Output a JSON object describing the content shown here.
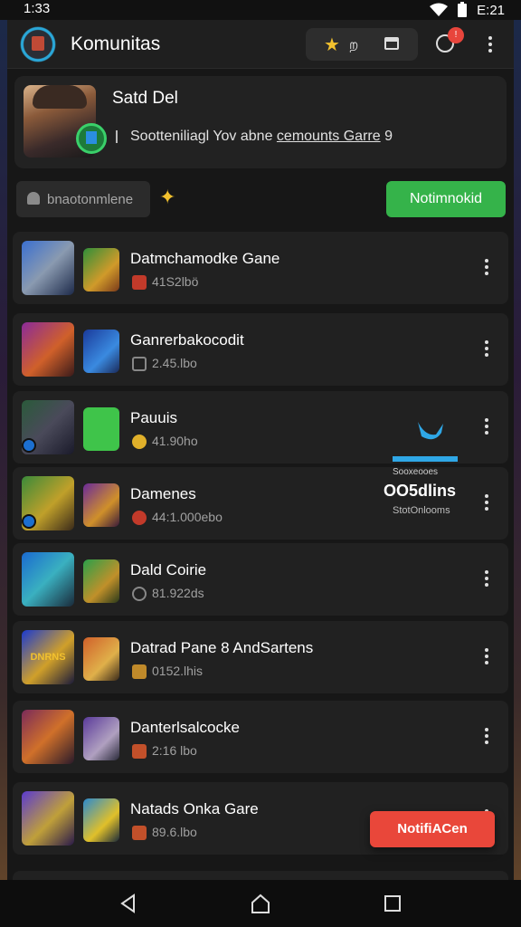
{
  "status_bar": {
    "time": "1:33",
    "clock": "E:21"
  },
  "app_bar": {
    "title": "Komunitas",
    "pill_text": "ற",
    "notification_count": "!"
  },
  "profile": {
    "name": "Satd Del",
    "subtitle_prefix": "Sootteniliagl Yov abne ",
    "subtitle_link": "cemounts Garre",
    "subtitle_suffix": " 9"
  },
  "filter": {
    "search_placeholder": "bnaotonmlene",
    "action_label": "Notimnokid"
  },
  "games": [
    {
      "title": "Datmchamodke Gane",
      "meta": "41S2lbö"
    },
    {
      "title": "Ganrerbakocodit",
      "meta": "2.45.lbo"
    },
    {
      "title": "Pauuis",
      "meta": "41.90ho"
    },
    {
      "title": "Damenes",
      "meta": "44:1.000ebo"
    },
    {
      "title": "Dald Coirie",
      "meta": "81.922ds"
    },
    {
      "title": "Datrad Pane 8 AndSartens",
      "meta": "0152.lhis"
    },
    {
      "title": "Danterlsalcocke",
      "meta": "2:16 lbo"
    },
    {
      "title": "Natads Onka Gare",
      "meta": "89.6.lbo"
    }
  ],
  "thumb_label_row6": "DNRNS",
  "overlay": {
    "small": "Sooxeooes",
    "big": "OO5dlins",
    "sub": "StotOnlooms"
  },
  "toast": {
    "label": "NotifiACen"
  },
  "colors": {
    "accent_green": "#35b34a",
    "toast_red": "#e9473a",
    "badge_red": "#e8453c",
    "link_blue": "#2fa7e6",
    "star_yellow": "#f2c12e"
  }
}
